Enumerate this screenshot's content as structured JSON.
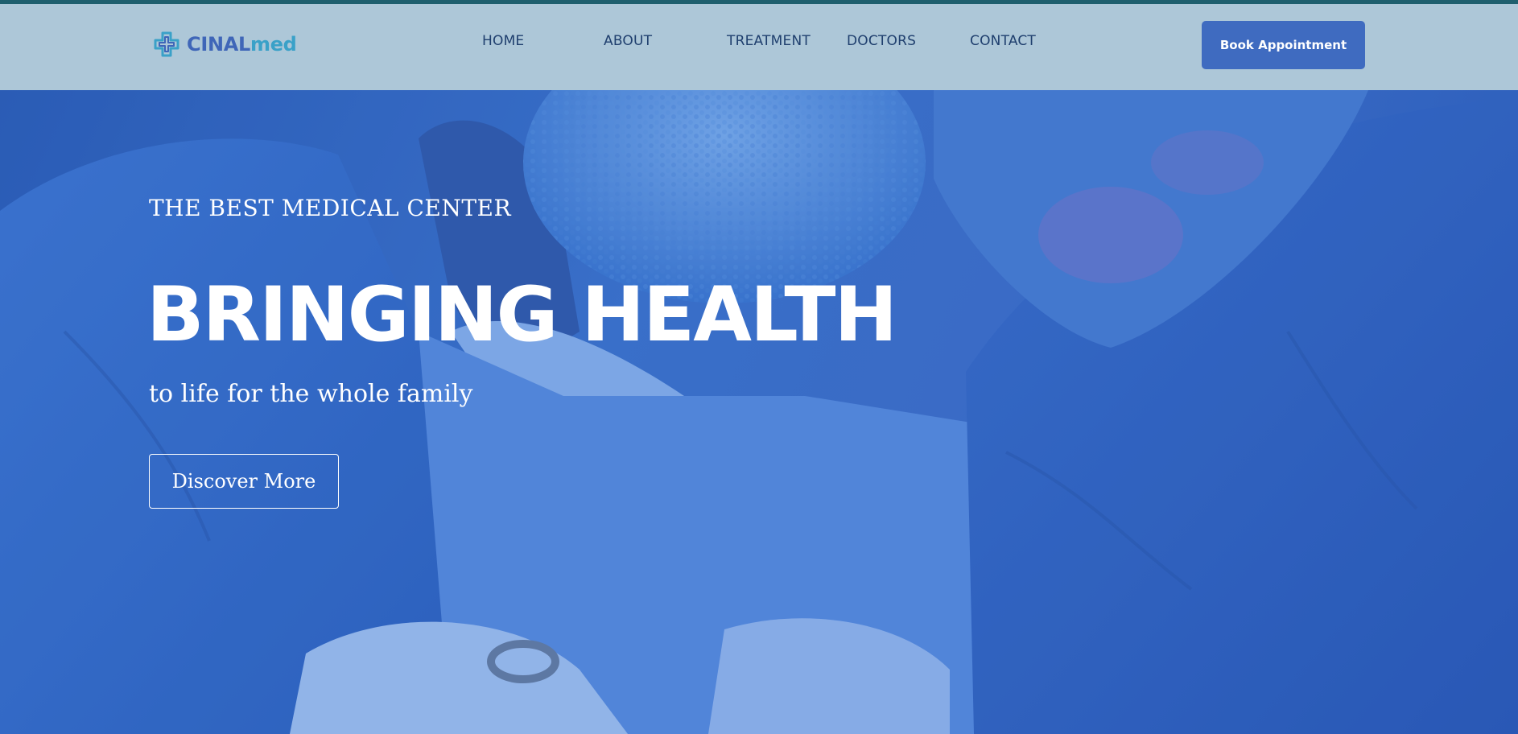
{
  "header": {
    "logo": {
      "icon": "medical-cross-icon",
      "text_part1": "CINAL",
      "text_part2": "med"
    },
    "nav": [
      {
        "label": "HOME"
      },
      {
        "label": "ABOUT"
      },
      {
        "label": "TREATMENT"
      },
      {
        "label": "DOCTORS"
      },
      {
        "label": "CONTACT"
      }
    ],
    "cta_label": "Book Appointment"
  },
  "hero": {
    "eyebrow": "THE BEST MEDICAL CENTER",
    "headline": "BRINGING HEALTH",
    "subline": "to life for the whole family",
    "button_label": "Discover More",
    "background": "surgeons-operating-photo"
  },
  "colors": {
    "top_rule": "#1f5f6e",
    "header_bg": "#adc7d8",
    "nav_text": "#1f3f6e",
    "cta_bg": "#3f6bc0",
    "logo_primary": "#3f66b8",
    "logo_secondary": "#3aa1c8",
    "hero_tint": "#3d74cc"
  }
}
